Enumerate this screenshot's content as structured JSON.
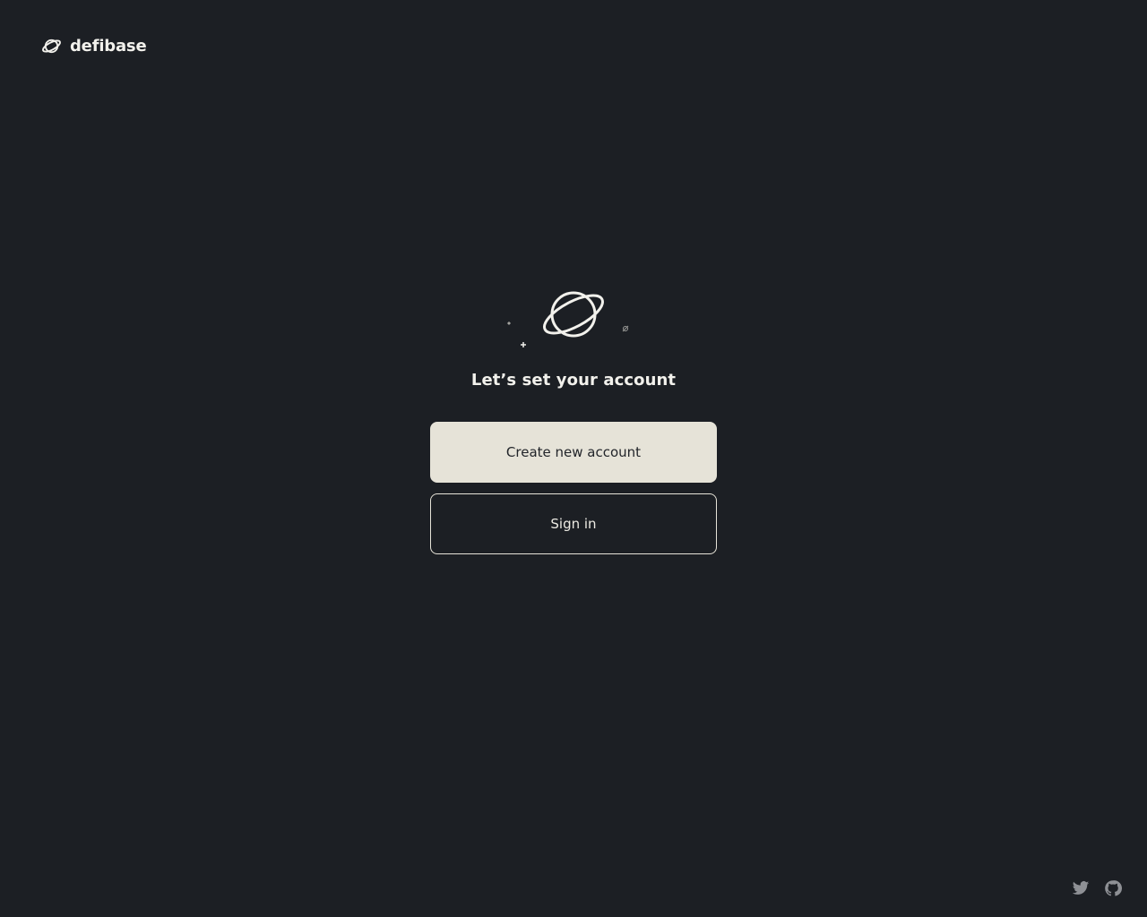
{
  "brand": {
    "name": "defibase",
    "logo_icon": "planet-icon"
  },
  "hero": {
    "illustration_icon": "planet-icon",
    "headline": "Let’s set your account"
  },
  "actions": {
    "create_account_label": "Create new account",
    "sign_in_label": "Sign in"
  },
  "footer": {
    "links": [
      {
        "icon": "twitter-icon"
      },
      {
        "icon": "github-icon"
      }
    ]
  },
  "colors": {
    "background": "#1c1f24",
    "primary_button": "#e6e3d8",
    "text": "#eceae3",
    "social_icons": "#8e9095"
  }
}
